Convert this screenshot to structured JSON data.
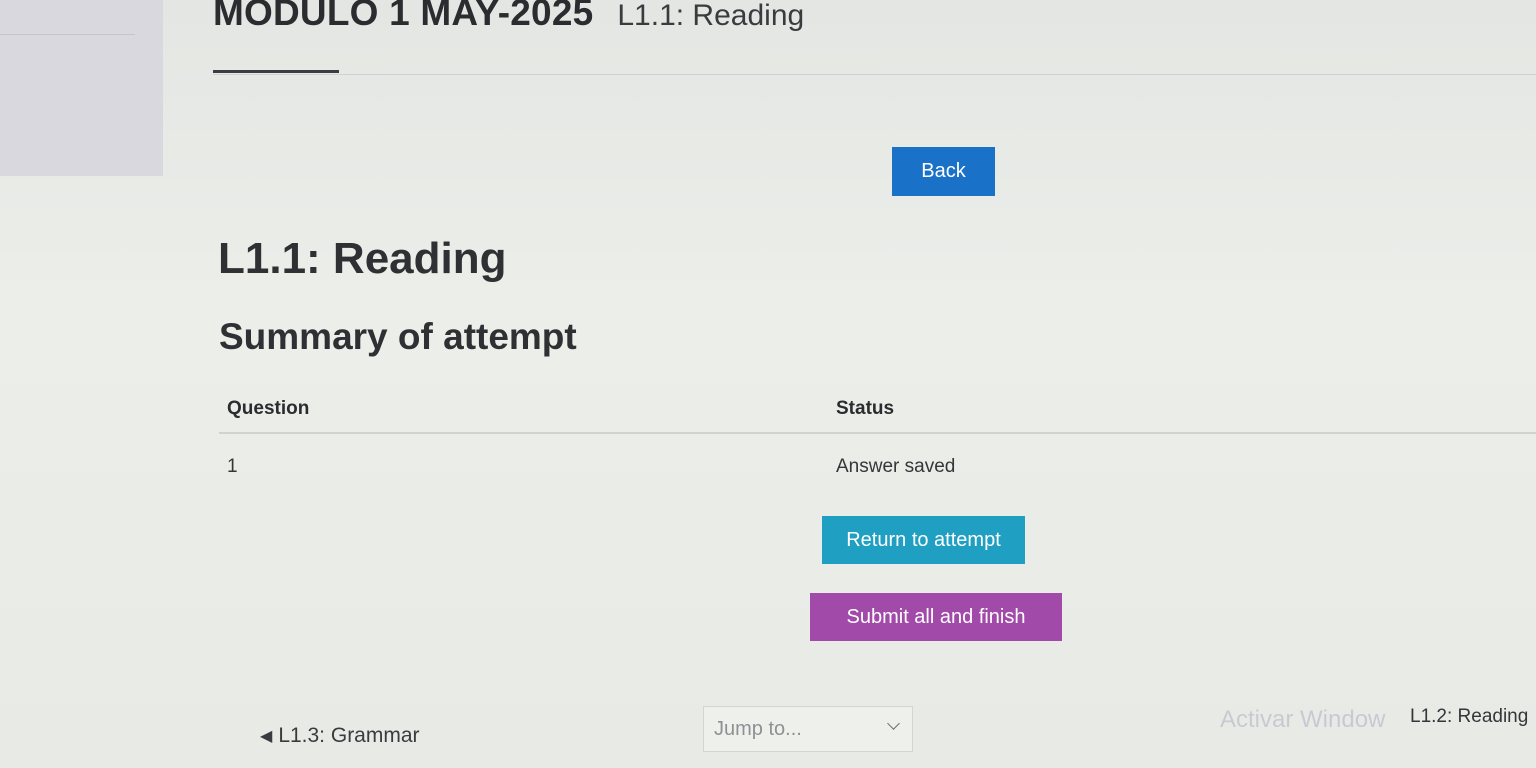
{
  "header": {
    "course_title": "MÓDULO 1 MAY-2025",
    "breadcrumb_current": "L1.1: Reading"
  },
  "actions": {
    "back_label": "Back",
    "return_label": "Return to attempt",
    "submit_label": "Submit all and finish"
  },
  "main": {
    "quiz_title": "L1.1: Reading",
    "summary_heading": "Summary of attempt",
    "table": {
      "columns": [
        "Question",
        "Status"
      ],
      "rows": [
        {
          "question": "1",
          "status": "Answer saved"
        }
      ]
    }
  },
  "footer": {
    "prev_label": "L1.3: Grammar",
    "prev_icon": "triangle-left-icon",
    "jump_placeholder": "Jump to...",
    "jump_icon": "chevron-down-icon",
    "next_label": "L1.2: Reading",
    "watermark": "Activar Window"
  },
  "colors": {
    "back_button": "#1a72c8",
    "return_button": "#1f9fc1",
    "submit_button": "#a24aa9"
  }
}
